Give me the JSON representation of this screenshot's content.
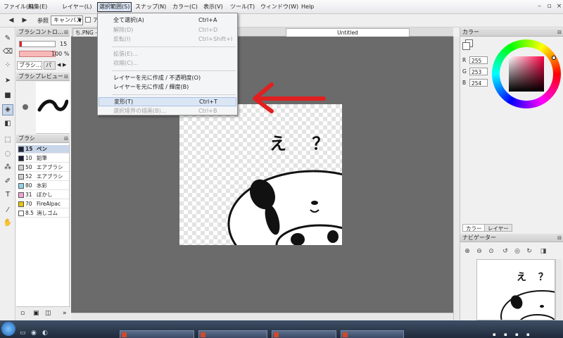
{
  "menu": {
    "items": [
      "ファイル(F)",
      "編集(E)",
      "レイヤー(L)",
      "選択範囲(S)",
      "スナップ(N)",
      "カラー(C)",
      "表示(V)",
      "ツール(T)",
      "ウィンドウ(W)",
      "Help"
    ],
    "active_index": 3
  },
  "toolbar": {
    "reference_label": "参照",
    "reference_value": "キャンバス",
    "checkbox_label": "ア"
  },
  "brush_control": {
    "title": "ブラシコントロ…",
    "size_value": "15",
    "opacity_value": "100 %",
    "tabs": [
      "ブラシ…",
      "パ"
    ]
  },
  "brush_preview": {
    "title": "ブラシプレビュー"
  },
  "brush_list": {
    "title": "ブラシ",
    "items": [
      {
        "size": "15",
        "name": "ペン",
        "color": "#1a1f3a",
        "selected": true
      },
      {
        "size": "10",
        "name": "鉛筆",
        "color": "#1a1f3a",
        "selected": false
      },
      {
        "size": "50",
        "name": "エアブラシ",
        "color": "#cfcfcf",
        "selected": false
      },
      {
        "size": "52",
        "name": "エアブラシ",
        "color": "#cfcfcf",
        "selected": false
      },
      {
        "size": "80",
        "name": "水彩",
        "color": "#8fd3ef",
        "selected": false
      },
      {
        "size": "31",
        "name": "ぼかし",
        "color": "#f2a4d6",
        "selected": false
      },
      {
        "size": "70",
        "name": "FireAlpac",
        "color": "#e8c600",
        "selected": false
      },
      {
        "size": "8.5",
        "name": "消しゴム",
        "color": "#ffffff",
        "selected": false
      }
    ]
  },
  "document_tabs": [
    {
      "label": "ち.PNG -",
      "active": false
    },
    {
      "label": "Untitled",
      "active": true
    }
  ],
  "dropdown": {
    "items": [
      {
        "label": "全て選択(A)",
        "shortcut": "Ctrl+A",
        "disabled": false,
        "highlight": false
      },
      {
        "label": "解除(D)",
        "shortcut": "Ctrl+D",
        "disabled": true,
        "highlight": false
      },
      {
        "label": "反転(I)",
        "shortcut": "Ctrl+Shift+I",
        "disabled": true,
        "highlight": false
      },
      {
        "separator": true
      },
      {
        "label": "拡張(E)...",
        "shortcut": "",
        "disabled": true,
        "highlight": false
      },
      {
        "label": "収縮(C)...",
        "shortcut": "",
        "disabled": true,
        "highlight": false
      },
      {
        "separator": true
      },
      {
        "label": "レイヤーを元に作成 / 不透明度(O)",
        "shortcut": "",
        "disabled": false,
        "highlight": false
      },
      {
        "label": "レイヤーを元に作成 / 輝度(B)",
        "shortcut": "",
        "disabled": false,
        "highlight": false
      },
      {
        "separator": true
      },
      {
        "label": "変形(T)",
        "shortcut": "Ctrl+T",
        "disabled": false,
        "highlight": true
      },
      {
        "label": "選択境界の描画(B)...",
        "shortcut": "Ctrl+B",
        "disabled": true,
        "highlight": false
      }
    ]
  },
  "color_panel": {
    "title": "カラー",
    "r_label": "R",
    "r_value": "255",
    "g_label": "G",
    "g_value": "253",
    "b_label": "B",
    "b_value": "254",
    "tabs": [
      "カラー",
      "レイヤー"
    ]
  },
  "navigator": {
    "title": "ナビゲーター"
  },
  "canvas_text": "え ？",
  "colors": {
    "arrow": "#e02020",
    "workspace": "#6b6b6b",
    "highlight": "#dbe6f5"
  }
}
